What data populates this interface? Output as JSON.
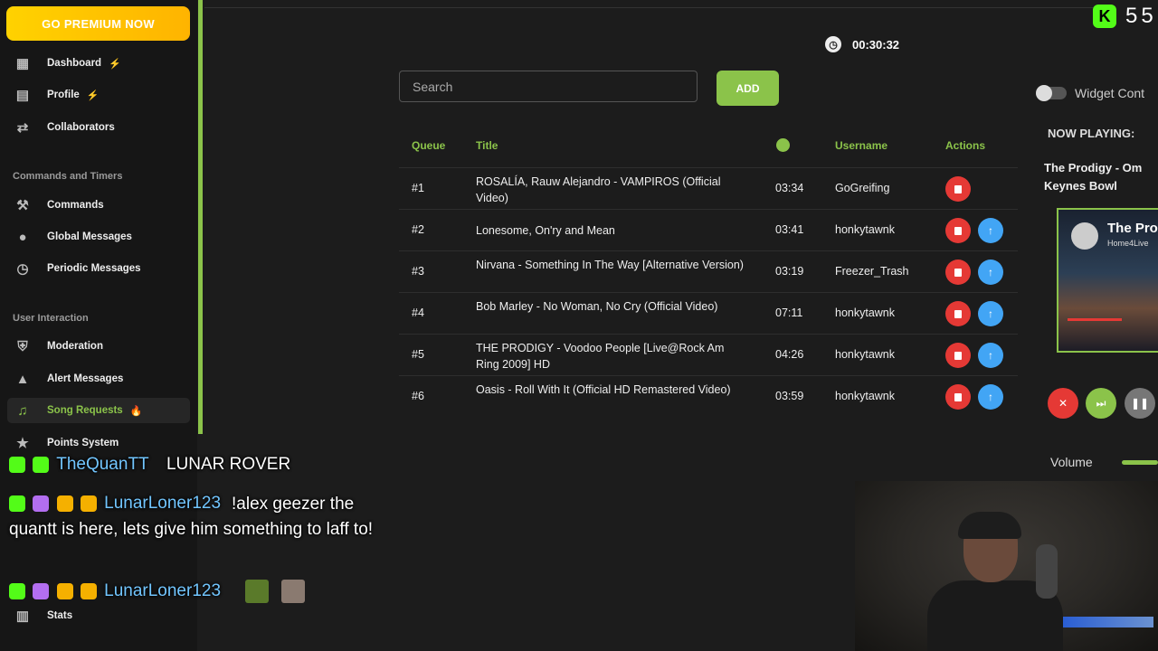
{
  "sidebar": {
    "premium_label": "GO PREMIUM NOW",
    "items": [
      {
        "label": "Dashboard",
        "icon": "grid-icon",
        "badge": "⚡"
      },
      {
        "label": "Profile",
        "icon": "profile-icon",
        "badge": "⚡"
      },
      {
        "label": "Collaborators",
        "icon": "collaborators-icon"
      },
      {
        "label": "Commands",
        "icon": "hammer-icon"
      },
      {
        "label": "Global Messages",
        "icon": "chat-bubble-icon"
      },
      {
        "label": "Periodic Messages",
        "icon": "clock-icon"
      },
      {
        "label": "Moderation",
        "icon": "shield-icon"
      },
      {
        "label": "Alert Messages",
        "icon": "alert-icon"
      },
      {
        "label": "Song Requests",
        "icon": "music-icon",
        "badge": "🔥"
      },
      {
        "label": "Points System",
        "icon": "star-icon"
      },
      {
        "label": "Stats",
        "icon": "bar-chart-icon"
      }
    ],
    "sections": {
      "commands_timers": "Commands and Timers",
      "user_interaction": "User Interaction"
    }
  },
  "header": {
    "timer": "00:30:32",
    "viewer_count": "55"
  },
  "search": {
    "placeholder": "Search",
    "add_label": "ADD"
  },
  "queue_table": {
    "headers": {
      "queue": "Queue",
      "title": "Title",
      "username": "Username",
      "actions": "Actions"
    },
    "rows": [
      {
        "queue": "#1",
        "title": "ROSALÍA, Rauw Alejandro - VAMPIROS (Official Video)",
        "duration": "03:34",
        "username": "GoGreifing"
      },
      {
        "queue": "#2",
        "title": "Lonesome, On'ry and Mean",
        "duration": "03:41",
        "username": "honkytawnk"
      },
      {
        "queue": "#3",
        "title": "Nirvana - Something In The Way [Alternative Version)",
        "duration": "03:19",
        "username": "Freezer_Trash"
      },
      {
        "queue": "#4",
        "title": "Bob Marley - No Woman, No Cry (Official Video)",
        "duration": "07:11",
        "username": "honkytawnk"
      },
      {
        "queue": "#5",
        "title": "THE PRODIGY - Voodoo People [Live@Rock Am Ring 2009] HD",
        "duration": "04:26",
        "username": "honkytawnk"
      },
      {
        "queue": "#6",
        "title": "Oasis - Roll With It (Official HD Remastered Video)",
        "duration": "03:59",
        "username": "honkytawnk"
      }
    ]
  },
  "player": {
    "widget_label": "Widget Cont",
    "now_playing_label": "NOW PLAYING:",
    "now_playing_title_line1": "The Prodigy - Om",
    "now_playing_title_line2": "Keynes Bowl",
    "thumb_title": "The Pro",
    "thumb_channel": "Home4Live",
    "volume_label": "Volume"
  },
  "chat": {
    "line1_user": "TheQuanTT",
    "line1_msg": "LUNAR ROVER",
    "line2_user": "LunarLoner123",
    "line2_msg": "!alex geezer the quantt is here, lets give him something to laff to!",
    "line3_user": "LunarLoner123"
  },
  "colors": {
    "accent": "#8bc34a",
    "premium": "#ffd200",
    "delete": "#e53935",
    "move_up": "#42a5f5",
    "kick_green": "#53fc18"
  }
}
